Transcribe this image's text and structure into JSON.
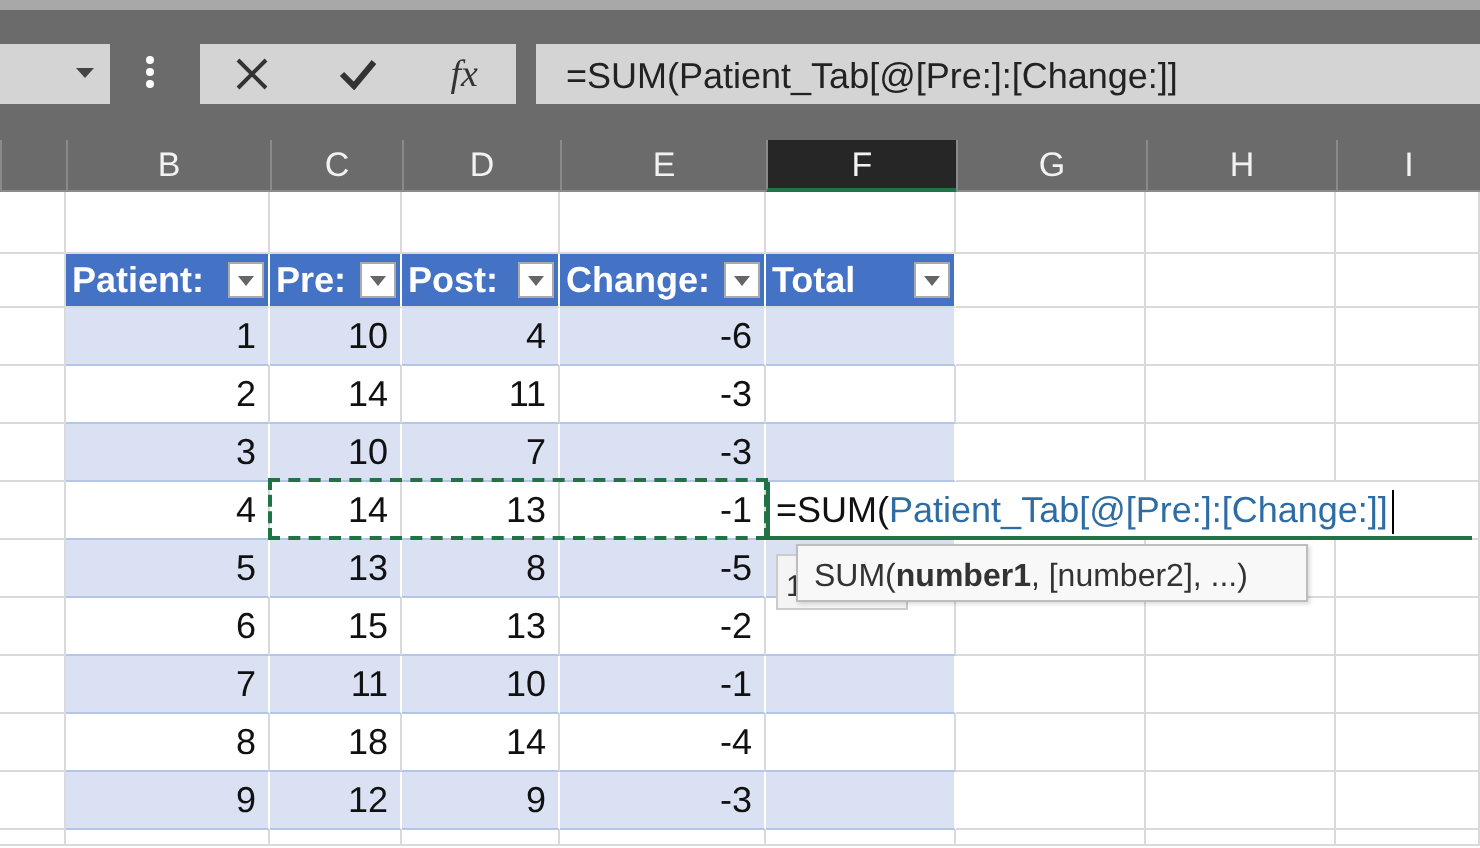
{
  "formula_bar": {
    "function_label": "fx",
    "value": "=SUM(Patient_Tab[@[Pre:]:[Change:]]"
  },
  "column_headers": [
    {
      "label": "B",
      "selected": false
    },
    {
      "label": "C",
      "selected": false
    },
    {
      "label": "D",
      "selected": false
    },
    {
      "label": "E",
      "selected": false
    },
    {
      "label": "F",
      "selected": true
    },
    {
      "label": "G",
      "selected": false
    },
    {
      "label": "H",
      "selected": false
    },
    {
      "label": "I",
      "selected": false
    }
  ],
  "table": {
    "columns": [
      "Patient:",
      "Pre:",
      "Post:",
      "Change:",
      "Total"
    ],
    "rows": [
      [
        "1",
        "10",
        "4",
        "-6"
      ],
      [
        "2",
        "14",
        "11",
        "-3"
      ],
      [
        "3",
        "10",
        "7",
        "-3"
      ],
      [
        "4",
        "14",
        "13",
        "-1"
      ],
      [
        "5",
        "13",
        "8",
        "-5"
      ],
      [
        "6",
        "15",
        "13",
        "-2"
      ],
      [
        "7",
        "11",
        "10",
        "-1"
      ],
      [
        "8",
        "18",
        "14",
        "-4"
      ],
      [
        "9",
        "12",
        "9",
        "-3"
      ]
    ]
  },
  "cell_editor": {
    "function": "=SUM(",
    "reference": "Patient_Tab[@[Pre:]:[Change:]]"
  },
  "tooltip": {
    "hidden_tip": "1",
    "signature": "SUM(**number1**, [number2], ...)"
  }
}
